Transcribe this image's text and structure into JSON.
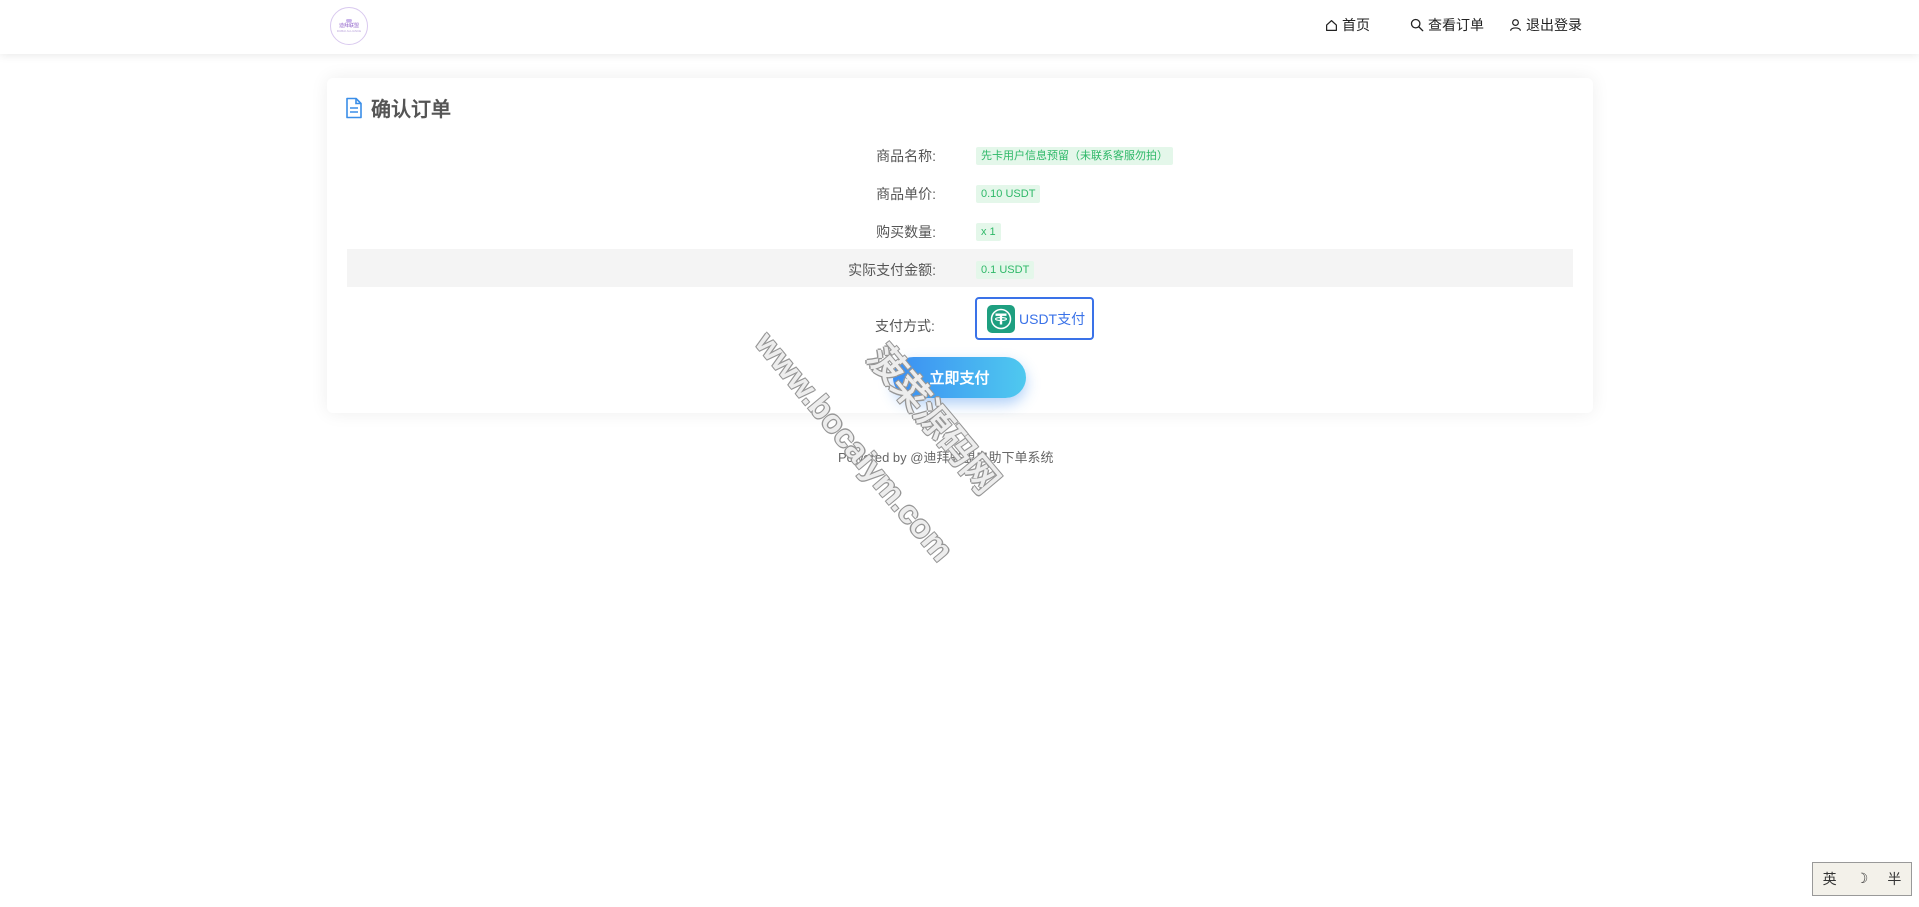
{
  "header": {
    "logo_title": "迪拜联盟",
    "logo_subtitle": "DUBAI ALLIANCE",
    "nav": [
      {
        "label": "首页",
        "icon": "home-icon"
      },
      {
        "label": "查看订单",
        "icon": "search-icon"
      },
      {
        "label": "退出登录",
        "icon": "user-icon"
      }
    ]
  },
  "order": {
    "title": "确认订单",
    "title_icon": "document-icon",
    "rows": [
      {
        "label": "商品名称:",
        "value": "先卡用户信息预留（未联系客服勿拍）"
      },
      {
        "label": "商品单价:",
        "value": "0.10 USDT"
      },
      {
        "label": "购买数量:",
        "value": "x 1"
      },
      {
        "label": "实际支付金额:",
        "value": "0.1 USDT"
      }
    ],
    "payment_label": "支付方式:",
    "payment_option": "USDT支付",
    "pay_button": "立即支付"
  },
  "footer": {
    "text": "Powered by @迪拜联盟自助下单系统"
  },
  "watermark": {
    "line1": "www.bocaiym.com",
    "line2": "菠菜源码网"
  },
  "ime": {
    "lang": "英",
    "moon": "☽",
    "half": "半"
  },
  "colors": {
    "accent": "#3a72e8",
    "tag_bg": "#e4f7ea",
    "tag_text": "#2eb868",
    "button_start": "#3b8ef3",
    "button_end": "#4fc9ef",
    "usdt_green": "#1e9f80"
  }
}
